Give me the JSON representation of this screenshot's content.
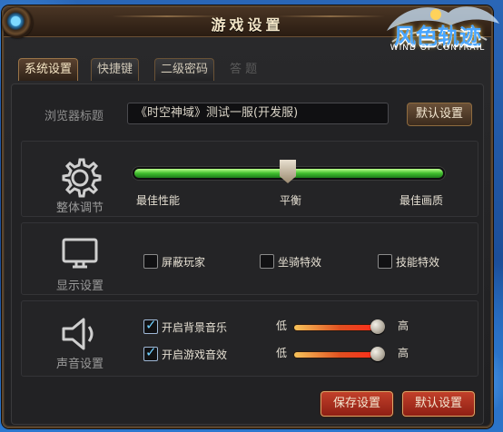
{
  "window": {
    "title": "游戏设置",
    "logo_text": "风色轨迹",
    "logo_subtext": "WIND OF CONTRAIL"
  },
  "tabs": [
    {
      "label": "系统设置",
      "active": true
    },
    {
      "label": "快捷键",
      "active": false
    },
    {
      "label": "二级密码",
      "active": false
    },
    {
      "label": "答 题",
      "active": false,
      "disabled": true
    }
  ],
  "browser_title": {
    "label": "浏览器标题",
    "value": "《时空神域》测试一服(开发服)",
    "default_button": "默认设置"
  },
  "overall": {
    "label": "整体调节",
    "icon": "gear-icon",
    "slider_value": 0.5,
    "left": "最佳性能",
    "middle": "平衡",
    "right": "最佳画质"
  },
  "display": {
    "label": "显示设置",
    "icon": "monitor-icon",
    "options": [
      {
        "label": "屏蔽玩家",
        "checked": false
      },
      {
        "label": "坐骑特效",
        "checked": false
      },
      {
        "label": "技能特效",
        "checked": false
      }
    ]
  },
  "sound": {
    "label": "声音设置",
    "icon": "speaker-icon",
    "rows": [
      {
        "label": "开启背景音乐",
        "checked": true,
        "low": "低",
        "high": "高",
        "volume": 1.0
      },
      {
        "label": "开启游戏音效",
        "checked": true,
        "low": "低",
        "high": "高",
        "volume": 1.0
      }
    ]
  },
  "footer": {
    "save": "保存设置",
    "default": "默认设置"
  },
  "colors": {
    "accent_red": "#b2351f",
    "slider_green": "#3fbd2d",
    "checkbox_checked": "#6fd0ff"
  }
}
